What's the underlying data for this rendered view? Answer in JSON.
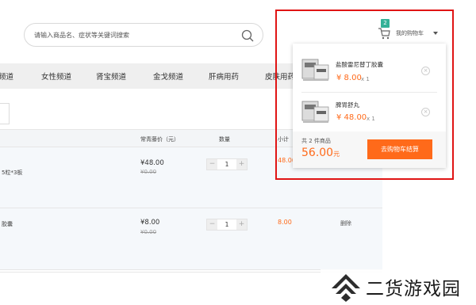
{
  "search": {
    "placeholder": "请输入商品名、症状等关键词搜索",
    "value": ""
  },
  "cart": {
    "badge": "2",
    "label": "我的购物车"
  },
  "nav": {
    "items": [
      "频道",
      "女性频道",
      "肾宝频道",
      "金戈频道",
      "肝病用药",
      "皮肤用药"
    ]
  },
  "table": {
    "headers": {
      "price": "常青藤价（元）",
      "qty": "数量",
      "subtotal": "小计"
    },
    "rows": [
      {
        "name": "5粒*3板",
        "price": "¥48.00",
        "original_price": "¥0.00",
        "qty": "1",
        "subtotal": "48.00",
        "action": ""
      },
      {
        "name": "胶囊",
        "price": "¥8.00",
        "original_price": "¥0.00",
        "qty": "1",
        "subtotal": "8.00",
        "action": "删除"
      }
    ],
    "stepper": {
      "minus": "−",
      "plus": "+"
    }
  },
  "dropdown": {
    "items": [
      {
        "name": "盐酸雷尼替丁胶囊",
        "price": "¥ 8.00",
        "qty": "x 1"
      },
      {
        "name": "脾胃舒丸",
        "price": "¥ 48.00",
        "qty": "x 1"
      }
    ],
    "remove": "×",
    "count_text": "共 2 件商品",
    "total": "56.00",
    "total_unit": "元",
    "checkout_label": "去购物车结算"
  },
  "watermark": {
    "text": "二货游戏园"
  },
  "colors": {
    "accent": "#ff6a1a",
    "badge": "#33b197",
    "highlight": "#e01414"
  }
}
